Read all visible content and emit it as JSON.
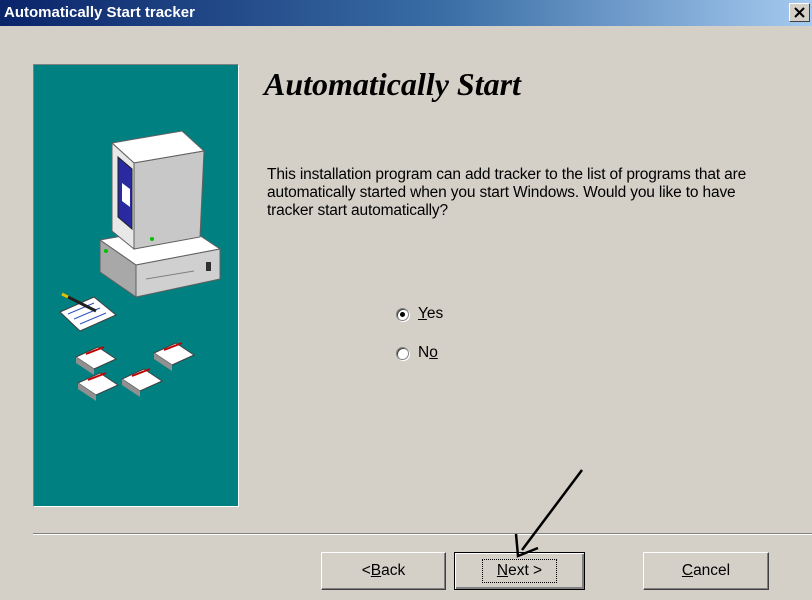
{
  "window": {
    "title": "Automatically Start tracker"
  },
  "wizard": {
    "heading": "Automatically Start",
    "description": "This installation program can add tracker to the list of programs that are automatically started when you start Windows.  Would you like to have tracker start automatically?"
  },
  "options": [
    {
      "pre": "",
      "key": "Y",
      "post": "es",
      "selected": true
    },
    {
      "pre": "N",
      "key": "o",
      "post": "",
      "selected": false
    }
  ],
  "buttons": {
    "back": {
      "pre": "< ",
      "key": "B",
      "post": "ack"
    },
    "next": {
      "pre": "",
      "key": "N",
      "post": "ext >"
    },
    "cancel": {
      "pre": "",
      "key": "C",
      "post": "ancel"
    }
  },
  "colors": {
    "panel": "#008080",
    "titlebar": "#0a246a",
    "face": "#d4d0c8"
  }
}
